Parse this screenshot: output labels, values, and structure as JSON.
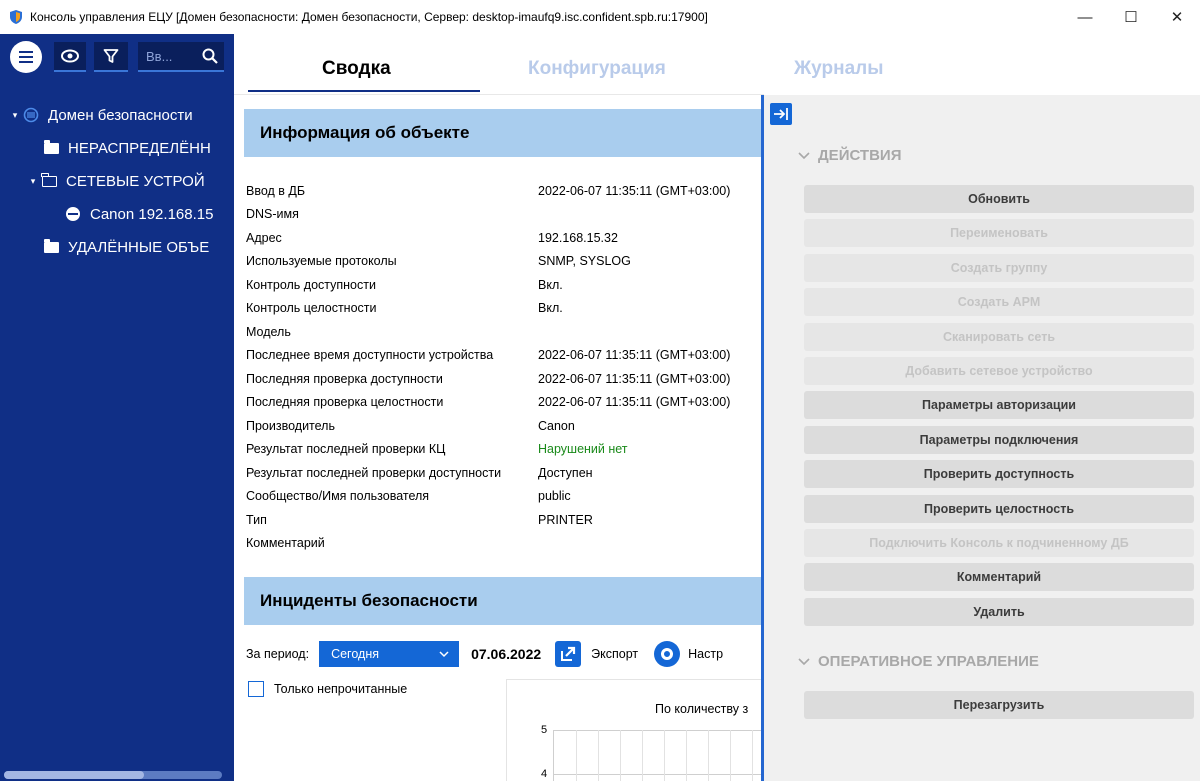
{
  "window": {
    "title": "Консоль управления ЕЦУ [Домен безопасности: Домен безопасности, Сервер: desktop-imaufq9.isc.confident.spb.ru:17900]",
    "minimize": "—",
    "maximize": "☐",
    "close": "✕"
  },
  "toolbar": {
    "search_placeholder": "Вв...",
    "eye_icon": "eye-icon",
    "filter_icon": "filter-icon"
  },
  "tree": [
    {
      "label": "Домен безопасности",
      "arrow": "▾",
      "icon": "domain-icon"
    },
    {
      "label": "НЕРАСПРЕДЕЛЁНН",
      "icon": "folder-icon"
    },
    {
      "label": "СЕТЕВЫЕ УСТРОЙ",
      "arrow": "▾",
      "icon": "folder-open-icon"
    },
    {
      "label": "Canon 192.168.15",
      "icon": "device-icon"
    },
    {
      "label": "УДАЛЁННЫЕ ОБЪЕ",
      "icon": "folder-icon"
    }
  ],
  "tabs": [
    "Сводка",
    "Конфигурация",
    "Журналы"
  ],
  "object_info": {
    "title": "Информация об объекте",
    "rows": [
      {
        "key": "Ввод в ДБ",
        "value": "2022-06-07 11:35:11 (GMT+03:00)"
      },
      {
        "key": "DNS-имя",
        "value": ""
      },
      {
        "key": "Адрес",
        "value": "192.168.15.32"
      },
      {
        "key": "Используемые протоколы",
        "value": "SNMP, SYSLOG"
      },
      {
        "key": "Контроль доступности",
        "value": "Вкл."
      },
      {
        "key": "Контроль целостности",
        "value": "Вкл."
      },
      {
        "key": "Модель",
        "value": ""
      },
      {
        "key": "Последнее время доступности устройства",
        "value": "2022-06-07 11:35:11 (GMT+03:00)"
      },
      {
        "key": "Последняя проверка доступности",
        "value": "2022-06-07 11:35:11 (GMT+03:00)"
      },
      {
        "key": "Последняя проверка целостности",
        "value": "2022-06-07 11:35:11 (GMT+03:00)"
      },
      {
        "key": "Производитель",
        "value": "Canon"
      },
      {
        "key": "Результат последней проверки КЦ",
        "value": "Нарушений нет",
        "ok": true
      },
      {
        "key": "Результат последней проверки доступности",
        "value": "Доступен"
      },
      {
        "key": "Сообщество/Имя пользователя",
        "value": "public"
      },
      {
        "key": "Тип",
        "value": "PRINTER"
      },
      {
        "key": "Комментарий",
        "value": ""
      }
    ]
  },
  "incidents": {
    "title": "Инциденты безопасности",
    "period_label": "За период:",
    "period_value": "Сегодня",
    "date": "07.06.2022",
    "export_label": "Экспорт",
    "settings_label": "Настр",
    "only_unread": "Только непрочитанные",
    "chart_title": "По количеству з",
    "y_ticks": [
      "5",
      "4"
    ]
  },
  "actions_group": {
    "title": "ДЕЙСТВИЯ",
    "buttons": [
      {
        "label": "Обновить",
        "enabled": true
      },
      {
        "label": "Переименовать",
        "enabled": false
      },
      {
        "label": "Создать группу",
        "enabled": false
      },
      {
        "label": "Создать АРМ",
        "enabled": false
      },
      {
        "label": "Сканировать сеть",
        "enabled": false
      },
      {
        "label": "Добавить сетевое устройство",
        "enabled": false
      },
      {
        "label": "Параметры авторизации",
        "enabled": true
      },
      {
        "label": "Параметры подключения",
        "enabled": true
      },
      {
        "label": "Проверить доступность",
        "enabled": true
      },
      {
        "label": "Проверить целостность",
        "enabled": true
      },
      {
        "label": "Подключить Консоль к подчиненному ДБ",
        "enabled": false
      },
      {
        "label": "Комментарий",
        "enabled": true
      },
      {
        "label": "Удалить",
        "enabled": true
      }
    ]
  },
  "operational_group": {
    "title": "ОПЕРАТИВНОЕ УПРАВЛЕНИЕ",
    "buttons": [
      {
        "label": "Перезагрузить",
        "enabled": true
      }
    ]
  },
  "colors": {
    "sidebar": "#102f86",
    "accent": "#1467d6",
    "section_header": "#a9cdee",
    "ok_text": "#1a8a1a"
  }
}
